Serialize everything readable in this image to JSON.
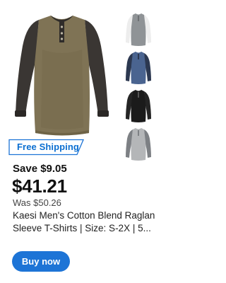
{
  "product": {
    "badge": "Free Shipping",
    "save_text": "Save $9.05",
    "price": "$41.21",
    "was_price": "Was $50.26",
    "title_line1": "Kaesi Men's Cotton Blend Raglan",
    "title_line2": "Sleeve T-Shirts | Size: S-2X | 5...",
    "buy_label": "Buy now",
    "main_image_icon": "shirt-olive-black-icon",
    "thumbnails": [
      {
        "icon": "shirt-gray-white-icon"
      },
      {
        "icon": "shirt-blue-navy-icon"
      },
      {
        "icon": "shirt-black-icon"
      },
      {
        "icon": "shirt-light-gray-icon"
      }
    ]
  },
  "colors": {
    "accent": "#1d74d6",
    "badge_text": "#0b6fd1"
  }
}
